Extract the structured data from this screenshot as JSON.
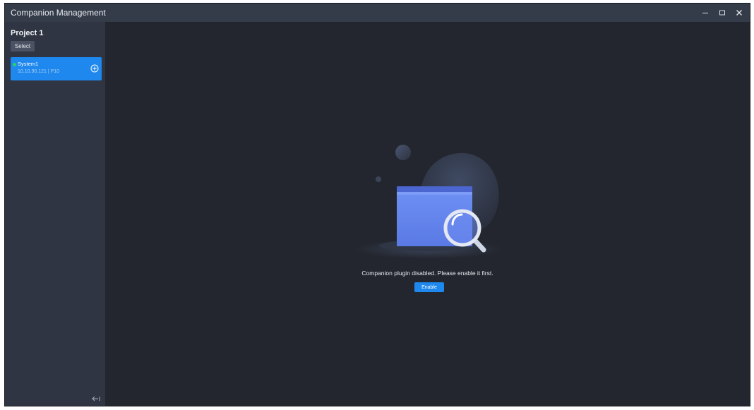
{
  "window": {
    "title": "Companion Management",
    "controls": [
      "minimize-icon",
      "maximize-icon",
      "close-icon"
    ]
  },
  "sidebar": {
    "project_name": "Project 1",
    "select_label": "Select",
    "systems": [
      {
        "name": "System1",
        "meta": "10.10.90.121 | P10",
        "status": "online",
        "status_color": "#25d366",
        "action_icon": "add-circle-icon"
      }
    ],
    "collapse_icon": "collapse-left-icon"
  },
  "main": {
    "empty_illustration": "folder-search-illustration",
    "message": "Companion plugin disabled. Please enable it first.",
    "enable_label": "Enable"
  },
  "colors": {
    "accent": "#1e88ee",
    "background": "#23262e",
    "sidebar": "#303543",
    "titlebar": "#343b49"
  }
}
